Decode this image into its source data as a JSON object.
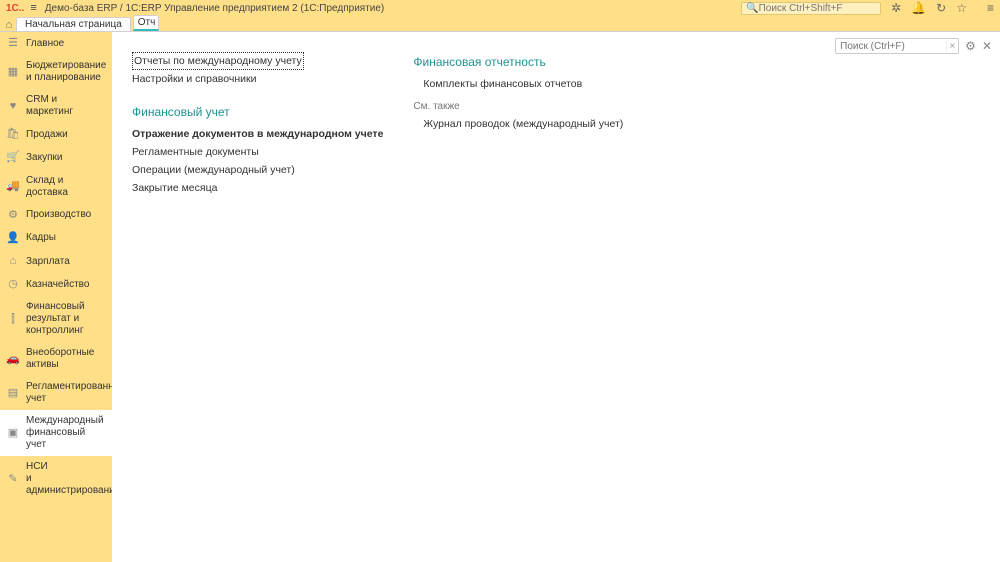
{
  "titlebar": {
    "logo": "1C..",
    "title": "Демо-база ERP / 1C:ERP Управление предприятием 2  (1С:Предприятие)",
    "search_placeholder": "Поиск Ctrl+Shift+F"
  },
  "tabs": {
    "home": "Начальная страница",
    "short": "Отч"
  },
  "sidebar": [
    {
      "icon": "☰",
      "label": "Главное"
    },
    {
      "icon": "▦",
      "label": "Бюджетирование\nи планирование"
    },
    {
      "icon": "♥",
      "label": "CRM и маркетинг"
    },
    {
      "icon": "🛍",
      "label": "Продажи"
    },
    {
      "icon": "🛒",
      "label": "Закупки"
    },
    {
      "icon": "🚚",
      "label": "Склад и доставка"
    },
    {
      "icon": "⚙",
      "label": "Производство"
    },
    {
      "icon": "👤",
      "label": "Кадры"
    },
    {
      "icon": "⌂",
      "label": "Зарплата"
    },
    {
      "icon": "◷",
      "label": "Казначейство"
    },
    {
      "icon": "⫿",
      "label": "Финансовый результат и контроллинг"
    },
    {
      "icon": "🚗",
      "label": "Внеоборотные активы"
    },
    {
      "icon": "▤",
      "label": "Регламентированный учет"
    },
    {
      "icon": "▣",
      "label": "Международный финансовый учет",
      "active": true
    },
    {
      "icon": "✎",
      "label": "НСИ\nи администрирование"
    }
  ],
  "content_search_placeholder": "Поиск (Ctrl+F)",
  "col1": {
    "item1": "Отчеты по международному учету",
    "item2": "Настройки и справочники",
    "heading": "Финансовый учет",
    "item3": "Отражение документов в международном учете",
    "item4": "Регламентные документы",
    "item5": "Операции (международный учет)",
    "item6": "Закрытие месяца"
  },
  "col2": {
    "heading": "Финансовая отчетность",
    "item1": "Комплекты финансовых отчетов",
    "sub": "См. также",
    "item2": "Журнал проводок (международный учет)"
  }
}
